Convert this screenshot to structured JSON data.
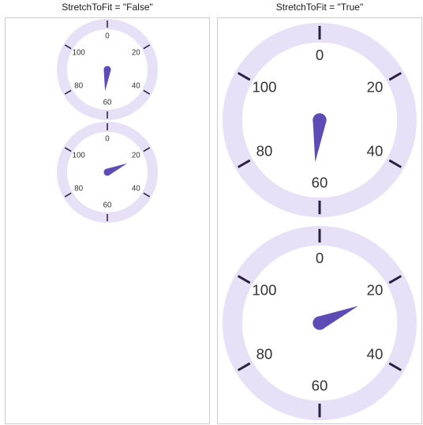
{
  "headers": {
    "left_prefix": "StretchToFit = ",
    "left_value": "\"False\"",
    "right_prefix": "StretchToFit = ",
    "right_value": "\"True\""
  },
  "gauge": {
    "ticks": [
      0,
      20,
      40,
      60,
      80,
      100
    ],
    "min": 0,
    "max": 120,
    "startAngle": -90,
    "sweep": 360,
    "ringColor": "#e7e1f7",
    "needleColor": "#5f4bb6",
    "tickColor": "#2b2140",
    "labelColor": "#333"
  },
  "panels": {
    "left": {
      "gauges": [
        {
          "value": 62,
          "size": 130
        },
        {
          "value": 22,
          "size": 130
        }
      ]
    },
    "right": {
      "gauges": [
        {
          "value": 62,
          "size": 248
        },
        {
          "value": 22,
          "size": 248
        }
      ]
    }
  },
  "chart_data": [
    {
      "type": "gauge",
      "panel": "left",
      "index": 0,
      "min": 0,
      "max": 120,
      "ticks": [
        0,
        20,
        40,
        60,
        80,
        100
      ],
      "value": 62,
      "title": "StretchToFit = \"False\""
    },
    {
      "type": "gauge",
      "panel": "left",
      "index": 1,
      "min": 0,
      "max": 120,
      "ticks": [
        0,
        20,
        40,
        60,
        80,
        100
      ],
      "value": 22,
      "title": "StretchToFit = \"False\""
    },
    {
      "type": "gauge",
      "panel": "right",
      "index": 0,
      "min": 0,
      "max": 120,
      "ticks": [
        0,
        20,
        40,
        60,
        80,
        100
      ],
      "value": 62,
      "title": "StretchToFit = \"True\""
    },
    {
      "type": "gauge",
      "panel": "right",
      "index": 1,
      "min": 0,
      "max": 120,
      "ticks": [
        0,
        20,
        40,
        60,
        80,
        100
      ],
      "value": 22,
      "title": "StretchToFit = \"True\""
    }
  ]
}
